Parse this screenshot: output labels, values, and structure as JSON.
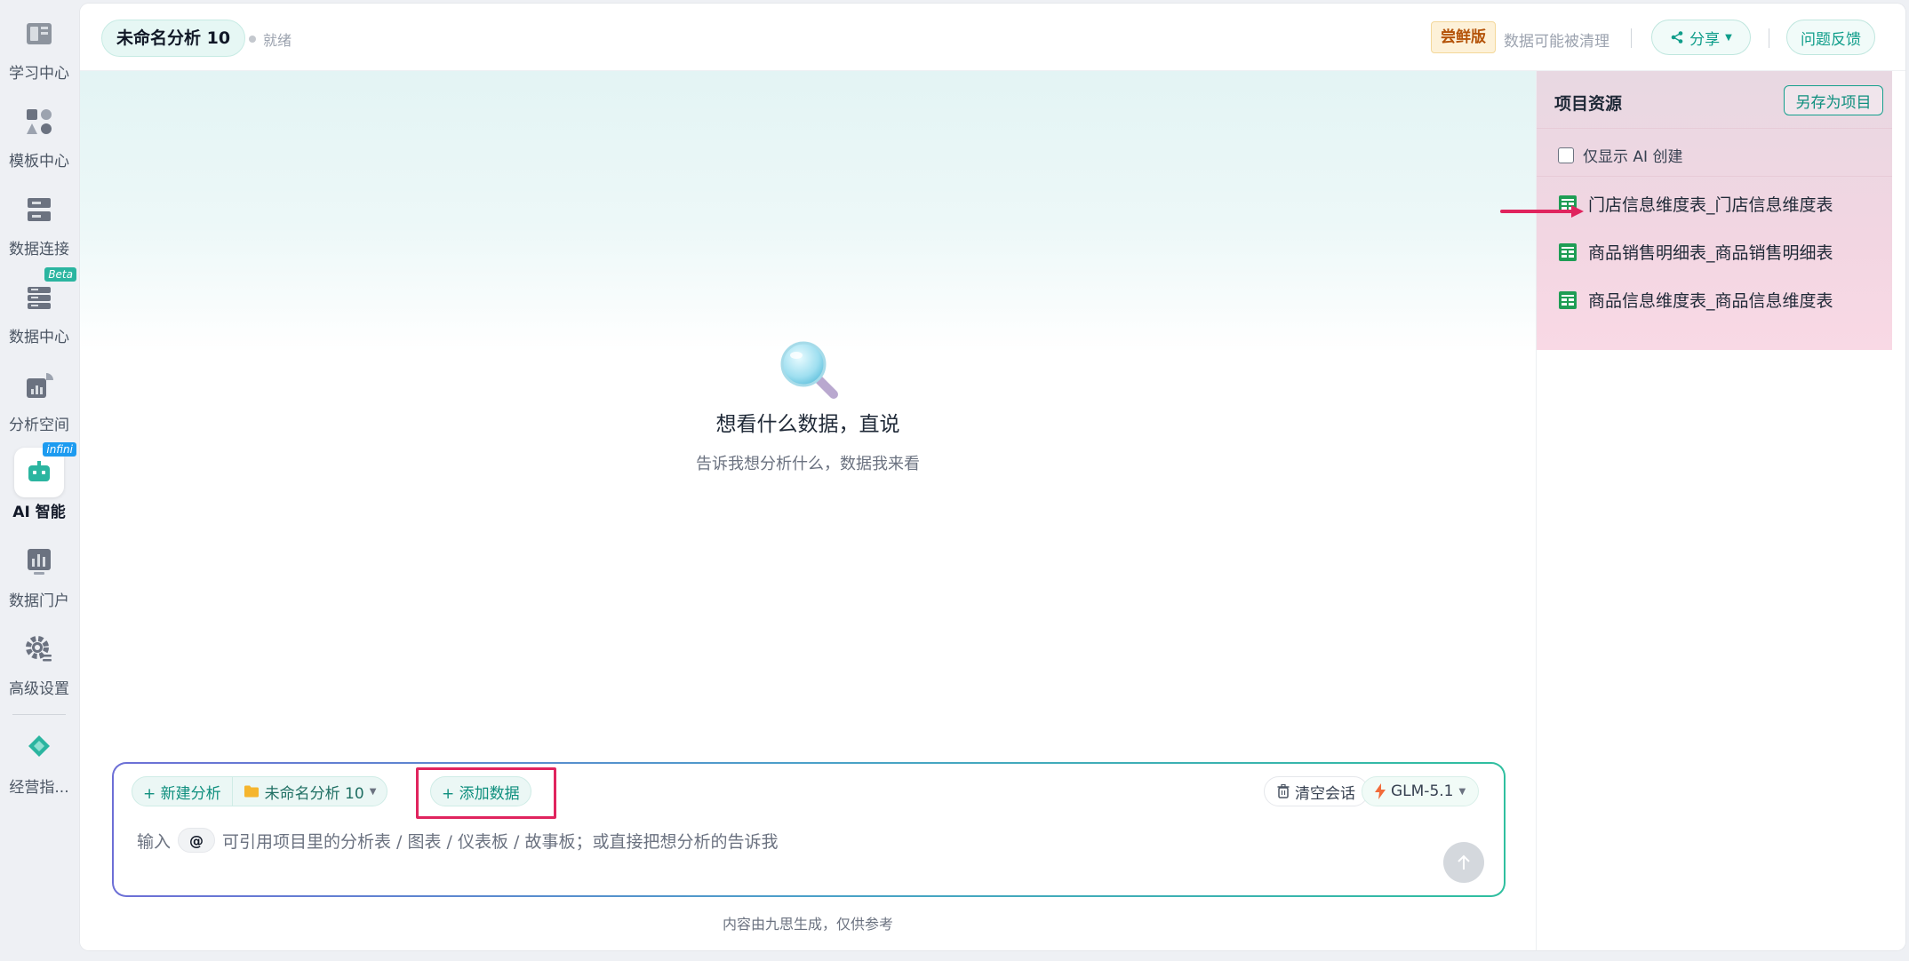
{
  "sidebar": {
    "items": [
      {
        "label": "学习中心",
        "icon": "book-icon"
      },
      {
        "label": "模板中心",
        "icon": "shapes-icon"
      },
      {
        "label": "数据连接",
        "icon": "server-icon"
      },
      {
        "label": "数据中心",
        "icon": "database-icon",
        "tag": "Beta"
      },
      {
        "label": "分析空间",
        "icon": "chart-pie-icon"
      },
      {
        "label": "AI 智能",
        "icon": "robot-icon",
        "tag": "infini",
        "active": true
      },
      {
        "label": "数据门户",
        "icon": "bar-chart-icon"
      },
      {
        "label": "高级设置",
        "icon": "gear-icon"
      },
      {
        "label": "经营指...",
        "icon": "diamond-logo-icon"
      }
    ]
  },
  "header": {
    "title": "未命名分析 10",
    "status": "就绪",
    "trial_badge": "尝鲜版",
    "trial_note": "数据可能被清理",
    "share_label": "分享",
    "feedback_label": "问题反馈"
  },
  "main": {
    "empty_title": "想看什么数据，直说",
    "empty_subtitle": "告诉我想分析什么，数据我来看",
    "footnote": "内容由九思生成，仅供参考"
  },
  "composer": {
    "new_analysis": "+ 新建分析",
    "project_name": "未命名分析 10",
    "add_data": "+ 添加数据",
    "clear_chat": "清空会话",
    "model": "GLM-5.1",
    "prompt_prefix": "输入",
    "at_symbol": "@",
    "prompt_rest": "可引用项目里的分析表 / 图表 / 仪表板 / 故事板；或直接把想分析的告诉我"
  },
  "panel": {
    "title": "项目资源",
    "save_as_project": "另存为项目",
    "filter_label": "仅显示 AI 创建",
    "filter_checked": false,
    "resources": [
      "门店信息维度表_门店信息维度表",
      "商品销售明细表_商品销售明细表",
      "商品信息维度表_商品信息维度表"
    ]
  },
  "colors": {
    "accent": "#0f9d8a",
    "highlight": "#e0245e",
    "trial": "#b45309"
  }
}
